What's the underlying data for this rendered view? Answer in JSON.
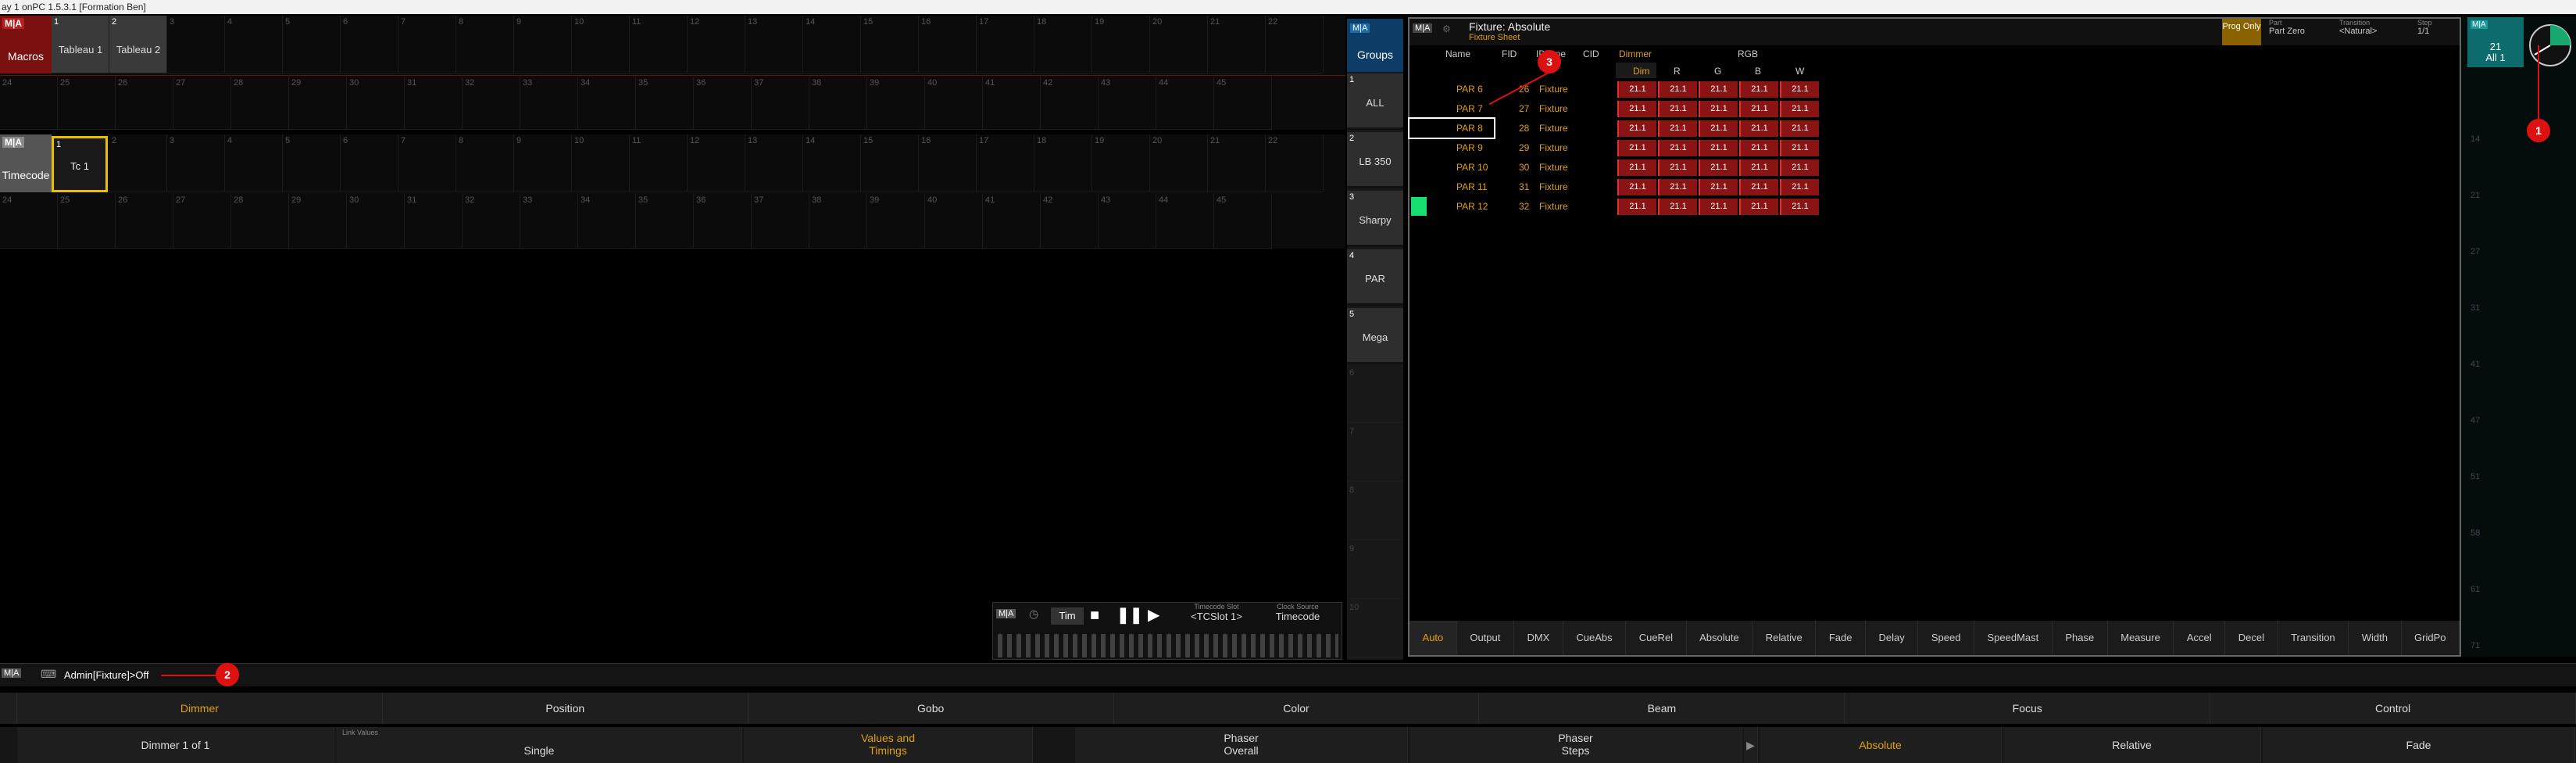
{
  "title_bar": "ay 1 onPC 1.5.3.1 [Formation Ben]",
  "macro_pool": {
    "label": "Macros",
    "macros": [
      {
        "num": "1",
        "label": "Tableau 1"
      },
      {
        "num": "2",
        "label": "Tableau 2"
      }
    ],
    "row1_nums": [
      "3",
      "4",
      "5",
      "6",
      "7",
      "8",
      "9",
      "10",
      "11",
      "12",
      "13",
      "14",
      "15",
      "16",
      "17",
      "18",
      "19",
      "20",
      "21",
      "22"
    ],
    "row2_nums": [
      "24",
      "25",
      "26",
      "27",
      "28",
      "29",
      "30",
      "31",
      "32",
      "33",
      "34",
      "35",
      "36",
      "37",
      "38",
      "39",
      "40",
      "41",
      "42",
      "43",
      "44",
      "45"
    ]
  },
  "timecode_pool": {
    "label": "Timecode",
    "item": {
      "num": "1",
      "label": "Tc 1"
    },
    "row1_nums": [
      "2",
      "3",
      "4",
      "5",
      "6",
      "7",
      "8",
      "9",
      "10",
      "11",
      "12",
      "13",
      "14",
      "15",
      "16",
      "17",
      "18",
      "19",
      "20",
      "21",
      "22"
    ],
    "row2_nums": [
      "24",
      "25",
      "26",
      "27",
      "28",
      "29",
      "30",
      "31",
      "32",
      "33",
      "34",
      "35",
      "36",
      "37",
      "38",
      "39",
      "40",
      "41",
      "42",
      "43",
      "44",
      "45"
    ]
  },
  "groups": {
    "title": "Groups",
    "items": [
      {
        "num": "1",
        "label": "ALL"
      },
      {
        "num": "2",
        "label": "LB 350"
      },
      {
        "num": "3",
        "label": "Sharpy"
      },
      {
        "num": "4",
        "label": "PAR"
      },
      {
        "num": "5",
        "label": "Mega"
      }
    ],
    "empty_nums": [
      "6",
      "7",
      "8",
      "9",
      "10"
    ]
  },
  "fixture_sheet": {
    "title": "Fixture: Absolute",
    "subtitle": "Fixture Sheet",
    "columns": {
      "name": "Name",
      "fid": "FID",
      "idtype": "IDType",
      "cid": "CID",
      "dimmer": "Dimmer",
      "rgb": "RGB"
    },
    "subcolumns": [
      "Dim",
      "R",
      "G",
      "B",
      "W"
    ],
    "rows": [
      {
        "name": "PAR 6",
        "fid": "26",
        "type": "Fixture",
        "values": [
          "21.1",
          "21.1",
          "21.1",
          "21.1",
          "21.1"
        ]
      },
      {
        "name": "PAR 7",
        "fid": "27",
        "type": "Fixture",
        "values": [
          "21.1",
          "21.1",
          "21.1",
          "21.1",
          "21.1"
        ]
      },
      {
        "name": "PAR 8",
        "fid": "28",
        "type": "Fixture",
        "values": [
          "21.1",
          "21.1",
          "21.1",
          "21.1",
          "21.1"
        ]
      },
      {
        "name": "PAR 9",
        "fid": "29",
        "type": "Fixture",
        "values": [
          "21.1",
          "21.1",
          "21.1",
          "21.1",
          "21.1"
        ]
      },
      {
        "name": "PAR 10",
        "fid": "30",
        "type": "Fixture",
        "values": [
          "21.1",
          "21.1",
          "21.1",
          "21.1",
          "21.1"
        ]
      },
      {
        "name": "PAR 11",
        "fid": "31",
        "type": "Fixture",
        "values": [
          "21.1",
          "21.1",
          "21.1",
          "21.1",
          "21.1"
        ]
      },
      {
        "name": "PAR 12",
        "fid": "32",
        "type": "Fixture",
        "values": [
          "21.1",
          "21.1",
          "21.1",
          "21.1",
          "21.1"
        ]
      }
    ],
    "prog_only": "Prog Only",
    "part_label": "Part",
    "part_value": "Part Zero",
    "transition_label": "Transition",
    "transition_value": "<Natural>",
    "step_label": "Step",
    "step_value": "1/1",
    "tabs": [
      "Auto",
      "Output",
      "DMX",
      "CueAbs",
      "CueRel",
      "Absolute",
      "Relative",
      "Fade",
      "Delay",
      "Speed",
      "SpeedMast",
      "Phase",
      "Measure",
      "Accel",
      "Decel",
      "Transition",
      "Width",
      "GridPo"
    ],
    "active_tab": "Auto"
  },
  "right_pane": {
    "head_num": "21",
    "head_label": "All 1",
    "row_nums": [
      "14",
      "21",
      "27",
      "31",
      "41",
      "47",
      "51",
      "58",
      "61",
      "71"
    ]
  },
  "timecode_player": {
    "label": "Tim",
    "slot_label": "Timecode Slot",
    "slot_value": "<TCSlot 1>",
    "clock_label": "Clock Source",
    "clock_value": "Timecode"
  },
  "command_line": {
    "text": "Admin[Fixture]>Off"
  },
  "encoder_bar": {
    "features": [
      "Dimmer",
      "Position",
      "Gobo",
      "Color",
      "Beam",
      "Focus",
      "Control"
    ],
    "active_feature": "Dimmer",
    "attribute": "Dimmer 1 of 1",
    "link_values_label": "Link Values",
    "link_values_value": "Single",
    "values_timings": "Values and Timings",
    "phaser_overall": "Phaser Overall",
    "phaser_steps": "Phaser Steps",
    "absolute": "Absolute",
    "relative": "Relative",
    "fade": "Fade"
  },
  "annotations": [
    "1",
    "2",
    "3"
  ],
  "colors": {
    "macro_header": "#7a1010",
    "groups_header": "#0d3d66",
    "selection": "#e8c000",
    "active_text": "#e0a010",
    "dimmer_cell": "#8a1313",
    "green_bar": "#18e070",
    "annotation": "#dd1111"
  }
}
